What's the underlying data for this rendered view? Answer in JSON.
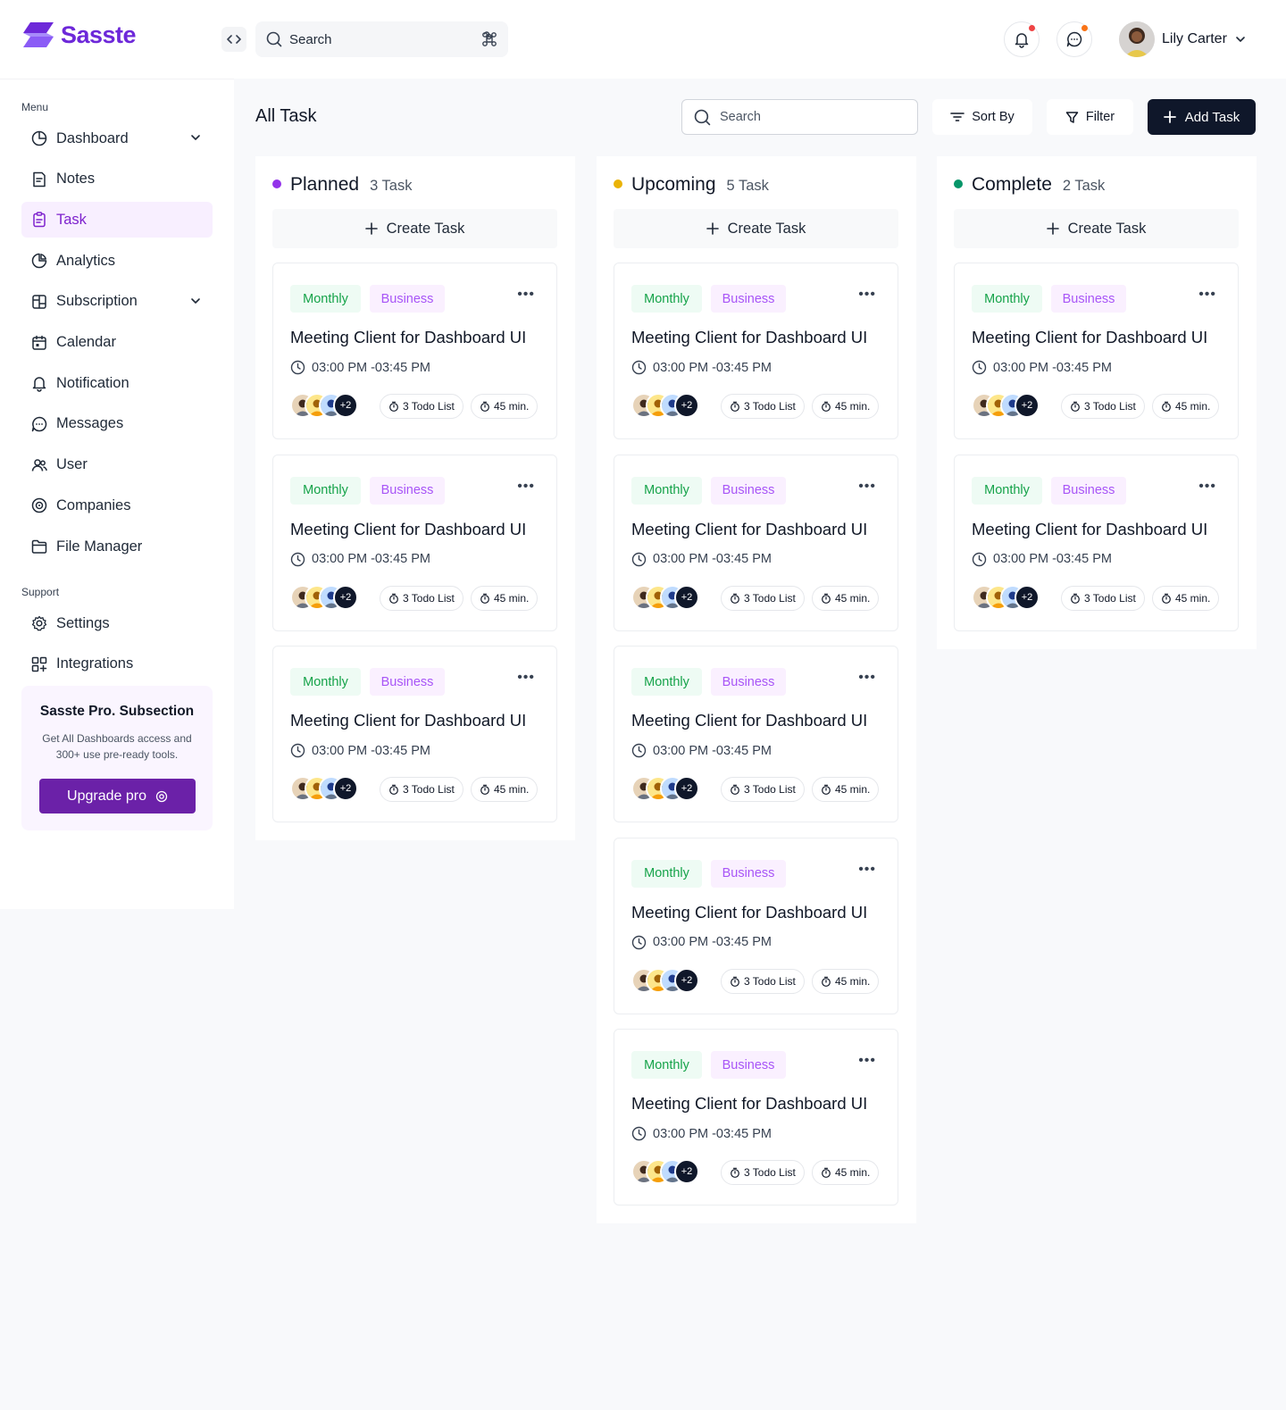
{
  "app": {
    "brand": "Sasste"
  },
  "topbar": {
    "search_placeholder": "Search",
    "user_name": "Lily Carter",
    "colors": {
      "notification_dot": "#ef4444",
      "message_dot": "#f97316"
    }
  },
  "sidebar": {
    "menu_label": "Menu",
    "support_label": "Support",
    "menu_items": [
      {
        "label": "Dashboard",
        "icon": "dashboard-icon",
        "has_chevron": true
      },
      {
        "label": "Notes",
        "icon": "notes-icon"
      },
      {
        "label": "Task",
        "icon": "task-icon",
        "active": true
      },
      {
        "label": "Analytics",
        "icon": "analytics-icon"
      },
      {
        "label": "Subscription",
        "icon": "subscription-icon",
        "has_chevron": true
      },
      {
        "label": "Calendar",
        "icon": "calendar-icon"
      },
      {
        "label": "Notification",
        "icon": "bell-icon"
      },
      {
        "label": "Messages",
        "icon": "chat-icon"
      },
      {
        "label": "User",
        "icon": "users-icon"
      },
      {
        "label": "Companies",
        "icon": "companies-icon"
      },
      {
        "label": "File Manager",
        "icon": "folder-icon"
      }
    ],
    "support_items": [
      {
        "label": "Settings",
        "icon": "gear-icon"
      },
      {
        "label": "Integrations",
        "icon": "integrations-icon"
      }
    ],
    "promo": {
      "title": "Sasste Pro. Subsection",
      "text": "Get All Dashboards access and 300+ use pre-ready tools.",
      "button": "Upgrade pro"
    }
  },
  "main": {
    "title": "All Task",
    "search_placeholder": "Search",
    "sort_label": "Sort By",
    "filter_label": "Filter",
    "add_label": "Add Task",
    "create_label": "Create Task",
    "columns": [
      {
        "title": "Planned",
        "count": "3 Task",
        "color": "#9333ea"
      },
      {
        "title": "Upcoming",
        "count": "5 Task",
        "color": "#eab308"
      },
      {
        "title": "Complete",
        "count": "2 Task",
        "color": "#059669"
      }
    ],
    "card": {
      "tag1": "Monthly",
      "tag2": "Business",
      "title": "Meeting Client for Dashboard UI",
      "time": "03:00 PM -03:45 PM",
      "extra_members": "+2",
      "todo": "3 Todo List",
      "duration": "45 min."
    }
  }
}
